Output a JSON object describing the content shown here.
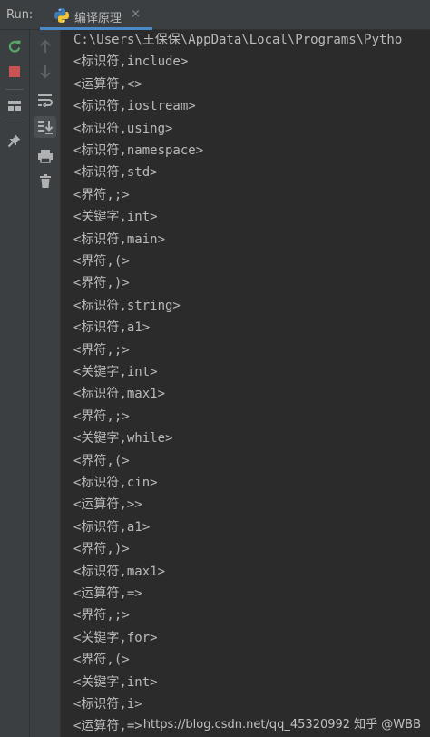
{
  "run_bar": {
    "label": "Run:",
    "tab": {
      "icon": "python-icon",
      "title": "编译原理",
      "close": "×"
    }
  },
  "toolbar": {
    "outer": [
      "rerun-icon",
      "stop-icon",
      "layout-icon",
      "pin-icon"
    ],
    "inner": [
      "up-arrow-icon",
      "down-arrow-icon",
      "soft-wrap-icon",
      "scroll-to-end-icon",
      "print-icon",
      "trash-icon"
    ]
  },
  "colors": {
    "background": "#2b2b2b",
    "toolbar": "#3c3f41",
    "text": "#bababa",
    "rerun": "#59a869",
    "stop": "#c75450",
    "tab_underline": "#4a88c7"
  },
  "console": {
    "lines": [
      "C:\\Users\\王保保\\AppData\\Local\\Programs\\Pytho",
      "<标识符,include>",
      "<运算符,<>",
      "<标识符,iostream>",
      "<标识符,using>",
      "<标识符,namespace>",
      "<标识符,std>",
      "<界符,;>",
      "<关键字,int>",
      "<标识符,main>",
      "<界符,(>",
      "<界符,)>",
      "<标识符,string>",
      "<标识符,a1>",
      "<界符,;>",
      "<关键字,int>",
      "<标识符,max1>",
      "<界符,;>",
      "<关键字,while>",
      "<界符,(>",
      "<标识符,cin>",
      "<运算符,>>",
      "<标识符,a1>",
      "<界符,)>",
      "<标识符,max1>",
      "<运算符,=>",
      "<界符,;>",
      "<关键字,for>",
      "<界符,(>",
      "<关键字,int>",
      "<标识符,i>",
      "<运算符,=>"
    ]
  },
  "watermark": "https://blog.csdn.net/qq_45320992  知乎 @WBB"
}
